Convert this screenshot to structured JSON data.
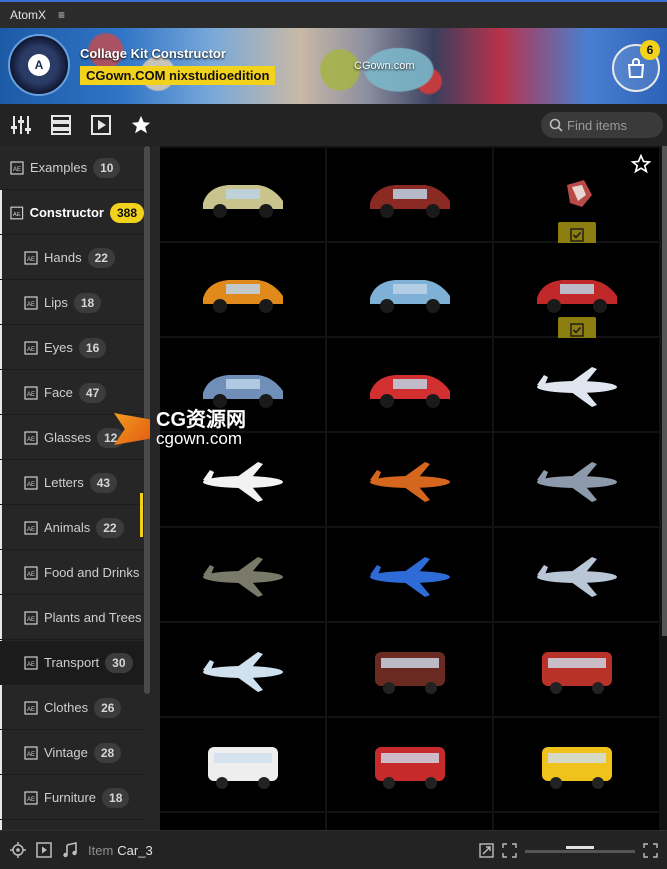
{
  "titlebar": {
    "app_name": "AtomX",
    "menu_glyph": "≡"
  },
  "banner": {
    "title": "Collage Kit Constructor",
    "subtitle": "CGown.COM nixstudioedition",
    "watermark": "CGown.com",
    "logo_letter": "A",
    "cart_count": "6"
  },
  "toolbar": {
    "icons": [
      "sliders-icon",
      "list-icon",
      "play-icon",
      "star-icon"
    ],
    "search_placeholder": "Find items"
  },
  "sidebar": {
    "items": [
      {
        "label": "Examples",
        "count": "10",
        "level": "top"
      },
      {
        "label": "Constructor",
        "count": "388",
        "level": "top",
        "state": "expanded"
      },
      {
        "label": "Hands",
        "count": "22",
        "level": "child"
      },
      {
        "label": "Lips",
        "count": "18",
        "level": "child"
      },
      {
        "label": "Eyes",
        "count": "16",
        "level": "child"
      },
      {
        "label": "Face",
        "count": "47",
        "level": "child"
      },
      {
        "label": "Glasses",
        "count": "12",
        "level": "child"
      },
      {
        "label": "Letters",
        "count": "43",
        "level": "child"
      },
      {
        "label": "Animals",
        "count": "22",
        "level": "child"
      },
      {
        "label": "Food and Drinks",
        "count": "",
        "level": "child"
      },
      {
        "label": "Plants and Trees",
        "count": "",
        "level": "child"
      },
      {
        "label": "Transport",
        "count": "30",
        "level": "child",
        "state": "active"
      },
      {
        "label": "Clothes",
        "count": "26",
        "level": "child"
      },
      {
        "label": "Vintage",
        "count": "28",
        "level": "child"
      },
      {
        "label": "Furniture",
        "count": "18",
        "level": "child"
      }
    ]
  },
  "grid": {
    "items": [
      {
        "icon": "van-icon",
        "color": "#c9c48e",
        "checked": false
      },
      {
        "icon": "vintage-car-icon",
        "color": "#8a2a22",
        "checked": false
      },
      {
        "icon": "rock-icon",
        "color": "#b84a4a",
        "checked": true
      },
      {
        "icon": "small-car-icon",
        "color": "#e08a1c",
        "checked": false
      },
      {
        "icon": "classic-car-icon",
        "color": "#7fb0d6",
        "checked": false
      },
      {
        "icon": "muscle-car-icon",
        "color": "#c0282a",
        "checked": true
      },
      {
        "icon": "sedan-icon",
        "color": "#6f8fb8",
        "checked": false
      },
      {
        "icon": "small-car-icon",
        "color": "#d23030",
        "checked": false
      },
      {
        "icon": "airliner-icon",
        "color": "#dfe6ef",
        "checked": false
      },
      {
        "icon": "airliner-icon",
        "color": "#f2f2f2",
        "checked": false
      },
      {
        "icon": "biplane-icon",
        "color": "#d4661e",
        "checked": false
      },
      {
        "icon": "fighter-jet-icon",
        "color": "#8c9aab",
        "checked": false
      },
      {
        "icon": "propeller-plane-icon",
        "color": "#7a7a6a",
        "checked": false
      },
      {
        "icon": "fighter-jet-icon",
        "color": "#2f6bd6",
        "checked": false
      },
      {
        "icon": "propeller-plane-icon",
        "color": "#b9c6d6",
        "checked": false
      },
      {
        "icon": "small-plane-icon",
        "color": "#cfe0ef",
        "checked": false
      },
      {
        "icon": "locomotive-icon",
        "color": "#6a2a22",
        "checked": false
      },
      {
        "icon": "tram-icon",
        "color": "#b8322a",
        "checked": false
      },
      {
        "icon": "bullet-train-icon",
        "color": "#eeeeee",
        "checked": false
      },
      {
        "icon": "bus-icon",
        "color": "#c62a2a",
        "checked": false
      },
      {
        "icon": "school-bus-icon",
        "color": "#f0c21c",
        "checked": false
      },
      {
        "icon": "vehicle-icon",
        "color": "#cfcfcf",
        "checked": false
      },
      {
        "icon": "vehicle-icon",
        "color": "#cfcfcf",
        "checked": false
      },
      {
        "icon": "vehicle-icon",
        "color": "#cfcfcf",
        "checked": false
      }
    ]
  },
  "status": {
    "item_label": "Item",
    "item_value": "Car_3"
  },
  "overlay": {
    "cg_line1": "CG资源网",
    "cg_line2": "cgown.com"
  },
  "colors": {
    "accent": "#f2d21b",
    "panel": "#262626",
    "grid_bg": "#000000"
  }
}
